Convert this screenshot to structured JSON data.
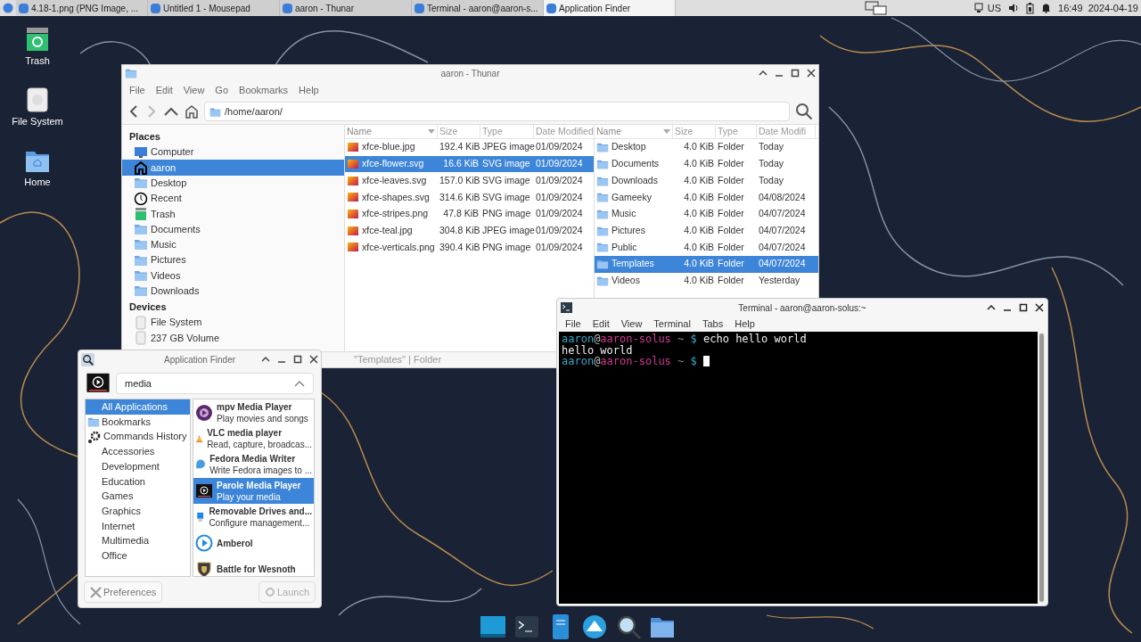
{
  "panel": {
    "tasks": [
      {
        "label": "4.18-1.png (PNG Image, ...",
        "selected": false
      },
      {
        "label": "Untitled 1 - Mousepad",
        "selected": false
      },
      {
        "label": "aaron - Thunar",
        "selected": false
      },
      {
        "label": "Terminal - aaron@aaron-s...",
        "selected": false
      },
      {
        "label": "Application Finder",
        "selected": true
      }
    ],
    "keyboard_layout": "US",
    "clock": "16:49  2024-04-19"
  },
  "desktop_icons": [
    {
      "label": "Trash"
    },
    {
      "label": "File System"
    },
    {
      "label": "Home"
    }
  ],
  "thunar": {
    "title": "aaron - Thunar",
    "menu": [
      "File",
      "Edit",
      "View",
      "Go",
      "Bookmarks",
      "Help"
    ],
    "path": "/home/aaron/",
    "sidebar": [
      {
        "heading": "Places",
        "items": [
          {
            "label": "Computer",
            "selected": false
          },
          {
            "label": "aaron",
            "selected": true
          },
          {
            "label": "Desktop",
            "selected": false
          },
          {
            "label": "Recent",
            "selected": false
          },
          {
            "label": "Trash",
            "selected": false
          },
          {
            "label": "Documents",
            "selected": false
          },
          {
            "label": "Music",
            "selected": false
          },
          {
            "label": "Pictures",
            "selected": false
          },
          {
            "label": "Videos",
            "selected": false
          },
          {
            "label": "Downloads",
            "selected": false
          }
        ]
      },
      {
        "heading": "Devices",
        "items": [
          {
            "label": "File System",
            "selected": false
          },
          {
            "label": "237 GB Volume",
            "selected": false
          }
        ]
      }
    ],
    "left_pane": {
      "columns": [
        {
          "label": "Name",
          "sorted": true
        },
        {
          "label": "Size",
          "sorted": false
        },
        {
          "label": "Type",
          "sorted": false
        },
        {
          "label": "Date Modified",
          "sorted": false
        }
      ],
      "rows": [
        {
          "name": "xfce-blue.jpg",
          "size": "192.4 KiB",
          "type": "JPEG image",
          "date": "01/09/2024",
          "selected": false
        },
        {
          "name": "xfce-flower.svg",
          "size": "16.6 KiB",
          "type": "SVG image",
          "date": "01/09/2024",
          "selected": true
        },
        {
          "name": "xfce-leaves.svg",
          "size": "157.0 KiB",
          "type": "SVG image",
          "date": "01/09/2024",
          "selected": false
        },
        {
          "name": "xfce-shapes.svg",
          "size": "314.6 KiB",
          "type": "SVG image",
          "date": "01/09/2024",
          "selected": false
        },
        {
          "name": "xfce-stripes.png",
          "size": "47.8 KiB",
          "type": "PNG image",
          "date": "01/09/2024",
          "selected": false
        },
        {
          "name": "xfce-teal.jpg",
          "size": "304.8 KiB",
          "type": "JPEG image",
          "date": "01/09/2024",
          "selected": false
        },
        {
          "name": "xfce-verticals.png",
          "size": "390.4 KiB",
          "type": "PNG image",
          "date": "01/09/2024",
          "selected": false
        }
      ]
    },
    "right_pane": {
      "columns": [
        {
          "label": "Name",
          "sorted": true
        },
        {
          "label": "Size",
          "sorted": false
        },
        {
          "label": "Type",
          "sorted": false
        },
        {
          "label": "Date Modifi",
          "sorted": false
        }
      ],
      "rows": [
        {
          "name": "Desktop",
          "size": "4.0 KiB",
          "type": "Folder",
          "date": "Today",
          "selected": false
        },
        {
          "name": "Documents",
          "size": "4.0 KiB",
          "type": "Folder",
          "date": "Today",
          "selected": false
        },
        {
          "name": "Downloads",
          "size": "4.0 KiB",
          "type": "Folder",
          "date": "Today",
          "selected": false
        },
        {
          "name": "Gameeky",
          "size": "4.0 KiB",
          "type": "Folder",
          "date": "04/08/2024",
          "selected": false
        },
        {
          "name": "Music",
          "size": "4.0 KiB",
          "type": "Folder",
          "date": "04/07/2024",
          "selected": false
        },
        {
          "name": "Pictures",
          "size": "4.0 KiB",
          "type": "Folder",
          "date": "04/07/2024",
          "selected": false
        },
        {
          "name": "Public",
          "size": "4.0 KiB",
          "type": "Folder",
          "date": "04/07/2024",
          "selected": false
        },
        {
          "name": "Templates",
          "size": "4.0 KiB",
          "type": "Folder",
          "date": "04/07/2024",
          "selected": true
        },
        {
          "name": "Videos",
          "size": "4.0 KiB",
          "type": "Folder",
          "date": "Yesterday",
          "selected": false
        }
      ]
    },
    "status": "\"Templates\" | Folder"
  },
  "app_finder": {
    "title": "Application Finder",
    "search": "media",
    "categories": [
      {
        "label": "All Applications",
        "selected": true
      },
      {
        "label": "Bookmarks",
        "selected": false
      },
      {
        "label": "Commands History",
        "selected": false
      },
      {
        "label": "Accessories",
        "selected": false
      },
      {
        "label": "Development",
        "selected": false
      },
      {
        "label": "Education",
        "selected": false
      },
      {
        "label": "Games",
        "selected": false
      },
      {
        "label": "Graphics",
        "selected": false
      },
      {
        "label": "Internet",
        "selected": false
      },
      {
        "label": "Multimedia",
        "selected": false
      },
      {
        "label": "Office",
        "selected": false
      }
    ],
    "apps": [
      {
        "name": "mpv Media Player",
        "description": "Play movies and songs",
        "selected": false
      },
      {
        "name": "VLC media player",
        "description": "Read, capture, broadcas...",
        "selected": false
      },
      {
        "name": "Fedora Media Writer",
        "description": "Write Fedora images to ...",
        "selected": false
      },
      {
        "name": "Parole Media Player",
        "description": "Play your media",
        "selected": true
      },
      {
        "name": "Removable Drives and...",
        "description": "Configure management...",
        "selected": false
      },
      {
        "name": "Amberol",
        "selected": false
      },
      {
        "name": "Battle for Wesnoth",
        "selected": false
      }
    ],
    "buttons": [
      {
        "label": "Preferences",
        "disabled": false
      },
      {
        "label": "Launch",
        "disabled": true
      }
    ]
  },
  "terminal": {
    "title": "Terminal - aaron@aaron-solus:~",
    "menu": [
      "File",
      "Edit",
      "View",
      "Terminal",
      "Tabs",
      "Help"
    ],
    "lines": [
      {
        "kind": "prompt",
        "user": "aaron",
        "at": "@",
        "host": "aaron-solus",
        "path": "~",
        "symbol": "$",
        "command": "echo hello world",
        "cursor": false
      },
      {
        "kind": "output",
        "text": "hello world"
      },
      {
        "kind": "prompt",
        "user": "aaron",
        "at": "@",
        "host": "aaron-solus",
        "path": "~",
        "symbol": "$",
        "cursor": true
      }
    ]
  }
}
